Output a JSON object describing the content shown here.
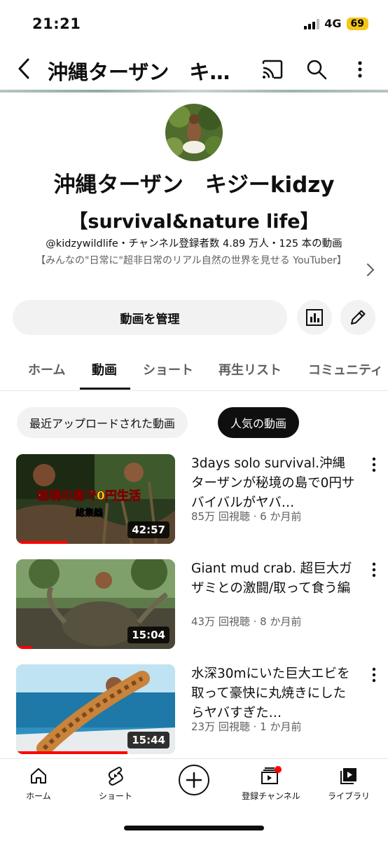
{
  "status_bar": {
    "time": "21:21",
    "network": "4G",
    "battery": "69"
  },
  "top_bar": {
    "title": "沖縄ターザン　キ…"
  },
  "channel": {
    "name": "沖縄ターザン　キジーkidzy",
    "subtitle": "【survival&nature life】",
    "meta": "@kidzywildlife・チャンネル登録者数 4.89 万人・125 本の動画",
    "description": "【みんなの\"日常に\"超非日常のリアル自然の世界を見せる YouTuber】"
  },
  "actions": {
    "manage_label": "動画を管理"
  },
  "tabs": [
    "ホーム",
    "動画",
    "ショート",
    "再生リスト",
    "コミュニティ"
  ],
  "chips": {
    "recent": "最近アップロードされた動画",
    "popular": "人気の動画"
  },
  "videos": [
    {
      "title": "3days solo survival.沖縄ターザンが秘境の島で0円サバイバルがヤバ…",
      "meta": "85万 回視聴 · 6 か月前",
      "duration": "42:57",
      "progress": 0.32,
      "overlay": "秘境の島で0円生活",
      "overlay_sub": "総集編"
    },
    {
      "title": "Giant mud crab. 超巨大ガザミとの激闘/取って食う編",
      "meta": "43万 回視聴 · 8 か月前",
      "duration": "15:04",
      "progress": 0.1
    },
    {
      "title": "水深30mにいた巨大エビを取って豪快に丸焼きにしたらヤバすぎた…",
      "meta": "23万 回視聴 · 1 か月前",
      "duration": "15:44",
      "progress": 0.7
    }
  ],
  "bottom_nav": {
    "home": "ホーム",
    "shorts": "ショート",
    "subscriptions": "登録チャンネル",
    "library": "ライブラリ"
  }
}
